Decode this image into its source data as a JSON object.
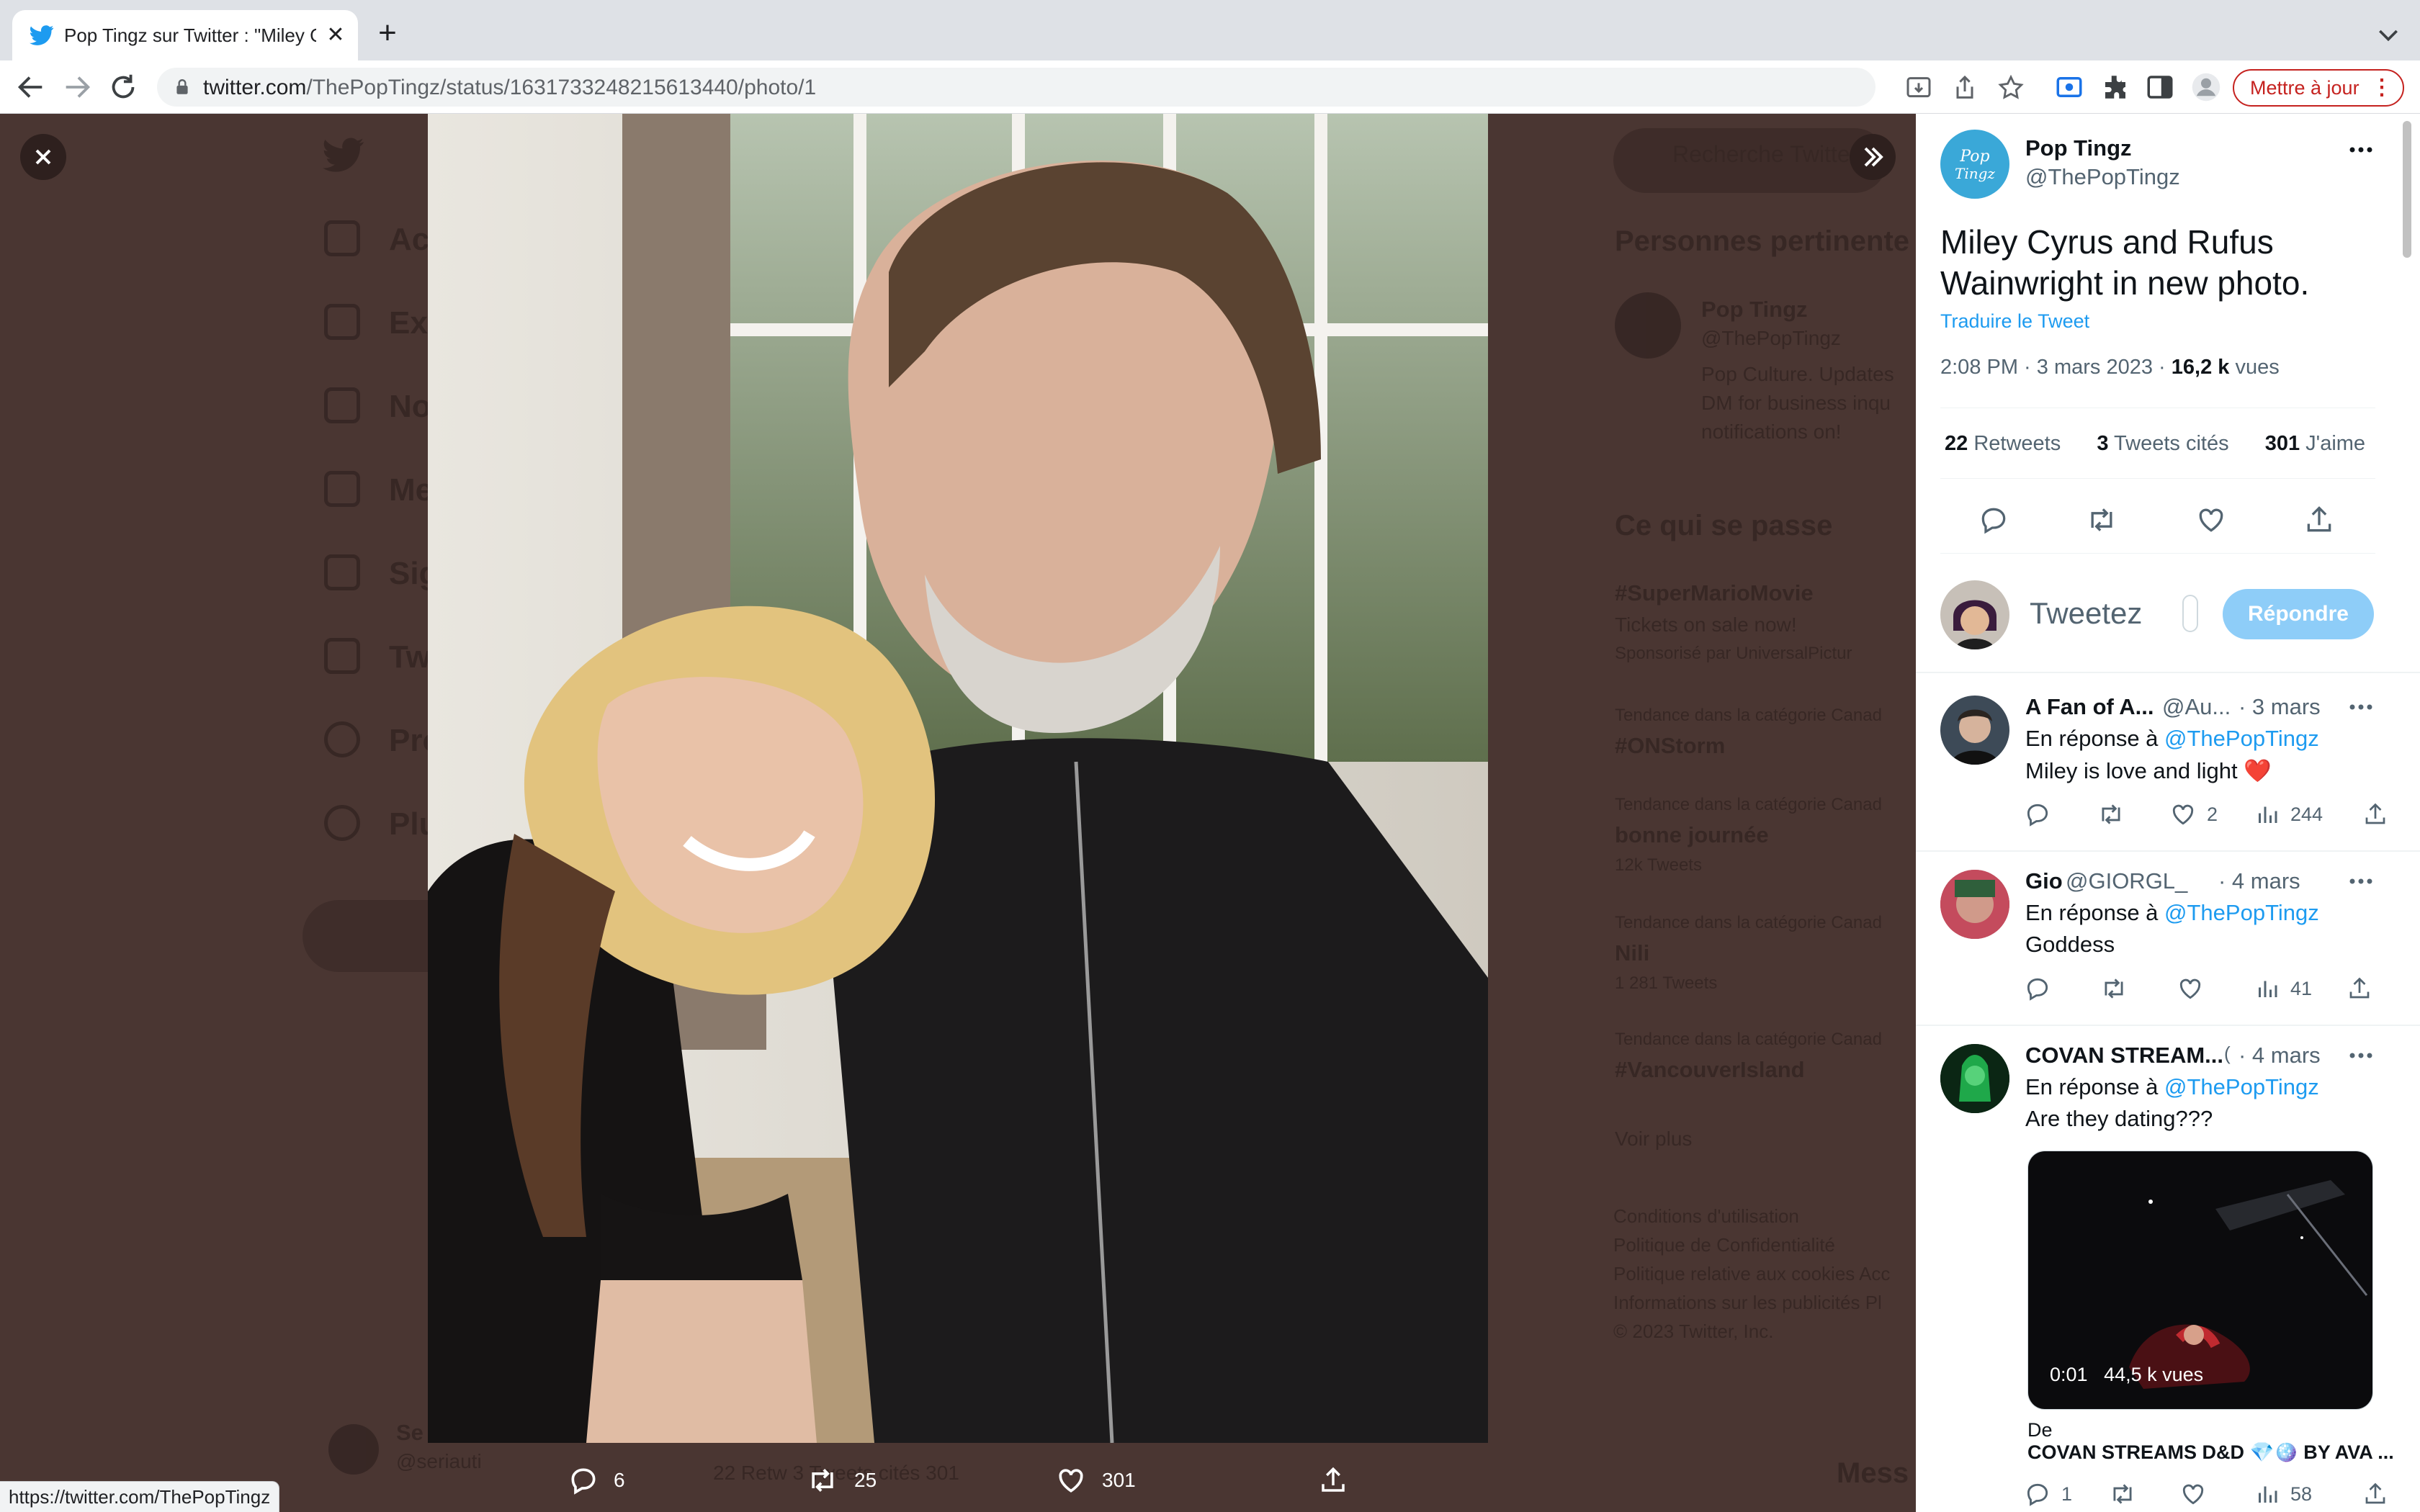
{
  "browser": {
    "tab_title": "Pop Tingz sur Twitter : \"Miley C",
    "url_host": "twitter.com",
    "url_path": "/ThePopTingz/status/1631733248215613440/photo/1",
    "update_button": "Mettre à jour",
    "status_bar_url": "https://twitter.com/ThePopTingz"
  },
  "background": {
    "nav": [
      "Ac",
      "Ex",
      "No",
      "Me",
      "Sig",
      "Tw",
      "Pro",
      "Plu"
    ],
    "search_placeholder": "Recherche Twitte",
    "relevant_heading": "Personnes pertinente",
    "relevant_name": "Pop Tingz",
    "relevant_handle": "@ThePopTingz",
    "relevant_bio_1": "Pop Culture. Updates",
    "relevant_bio_2": "DM for business inqu",
    "relevant_bio_3": "notifications on!",
    "trends_heading": "Ce qui se passe",
    "trend_1": "#SuperMarioMovie",
    "trend_1_sub": "Tickets on sale now!",
    "trend_1_promo": "Sponsorisé par UniversalPictur",
    "trend_2_cat": "Tendance dans la catégorie Canad",
    "trend_2": "#ONStorm",
    "trend_3_cat": "Tendance dans la catégorie Canad",
    "trend_3": "bonne journée",
    "trend_3_count": "12k Tweets",
    "trend_4_cat": "Tendance dans la catégorie Canad",
    "trend_4": "Nili",
    "trend_4_count": "1 281 Tweets",
    "trend_5_cat": "Tendance dans la catégorie Canad",
    "trend_5": "#VancouverIsland",
    "see_more": "Voir plus",
    "footer_1": "Conditions d'utilisation",
    "footer_2": "Politique de Confidentialité",
    "footer_3": "Politique relative aux cookies    Acc",
    "footer_4": "Informations sur les publicités    Pl",
    "footer_5": "© 2023 Twitter, Inc.",
    "bottom_user": "Se",
    "bottom_handle": "@seriauti",
    "bottom_stats": "22 Retw      3 Tweets cités     301",
    "messages": "Mess"
  },
  "photo_bar": {
    "replies": "6",
    "retweets": "25",
    "likes": "301"
  },
  "tweet": {
    "author_name": "Pop Tingz",
    "author_handle": "@ThePopTingz",
    "text": "Miley Cyrus and Rufus Wainwright in new photo.",
    "translate": "Traduire le Tweet",
    "time": "2:08 PM · 3 mars 2023 · ",
    "views_count": "16,2 k",
    "views_label": " vues",
    "retweets_count": "22",
    "retweets_label": " Retweets",
    "quotes_count": "3",
    "quotes_label": " Tweets cités",
    "likes_count": "301",
    "likes_label": " J'aime"
  },
  "composer": {
    "placeholder": "Tweetez",
    "reply_button": "Répondre"
  },
  "replies": [
    {
      "name": "A Fan of A...",
      "handle": "@Au...",
      "date": "· 3 mars",
      "reply_to_prefix": "En réponse à ",
      "reply_to": "@ThePopTingz",
      "text": "Miley is love and light ❤️",
      "likes": "2",
      "views": "244"
    },
    {
      "name": "Gio",
      "handle": "@GIORGL_",
      "date": "· 4 mars",
      "reply_to_prefix": "En réponse à ",
      "reply_to": "@ThePopTingz",
      "text": "Goddess",
      "views": "41"
    },
    {
      "name": "COVAN STREAM...",
      "handle": "(",
      "date": "· 4 mars",
      "reply_to_prefix": "En réponse à ",
      "reply_to": "@ThePopTingz",
      "text": "Are they dating???",
      "video_time": "0:01",
      "video_views": "44,5 k vues",
      "video_from": "De",
      "video_title": "COVAN STREAMS D&D 💎🪩 BY AVA ...",
      "replies": "1",
      "views": "58"
    }
  ],
  "colors": {
    "twitter_blue": "#1d9bf0",
    "overlay": "#4a3632",
    "update_red": "#c5221f"
  }
}
